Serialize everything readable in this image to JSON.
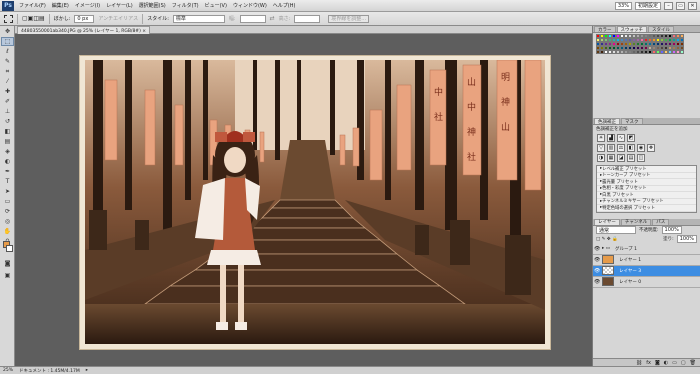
{
  "menubar": {
    "items": [
      "ファイル(F)",
      "編集(E)",
      "イメージ(I)",
      "レイヤー(L)",
      "選択範囲(S)",
      "フィルタ(T)",
      "ビュー(V)",
      "ウィンドウ(W)",
      "ヘルプ(H)"
    ],
    "zoom": "33%",
    "workspace": "初期設定"
  },
  "options": {
    "feather_label": "ぼかし:",
    "feather_value": "0 px",
    "antialias_label": "アンチエイリアス",
    "style_label": "スタイル:",
    "style_value": "標準",
    "width_label": "幅:",
    "height_label": "高さ:",
    "refine_label": "境界線を調整..."
  },
  "document": {
    "tab_label": "44803550001ab340.JPG @ 25% (レイヤー 1, RGB/8#) ×"
  },
  "statusbar": {
    "zoom": "25%",
    "doc_info": "ドキュメント : 1.45M/4.17M"
  },
  "panels": {
    "swatches_tabs": [
      "カラー",
      "スウォッチ",
      "スタイル"
    ],
    "swatch_colors": [
      "#ff0000",
      "#ffff00",
      "#00ff00",
      "#00ffff",
      "#0000ff",
      "#ff00ff",
      "#ffffff",
      "#ebebeb",
      "#d6d6d6",
      "#c2c2c2",
      "#adadad",
      "#999999",
      "#858585",
      "#707070",
      "#5c5c5c",
      "#474747",
      "#333333",
      "#1f1f1f",
      "#000000",
      "#f26d7d",
      "#f68e56",
      "#fbaf5c",
      "#fff467",
      "#acd372",
      "#7cc576",
      "#3bb878",
      "#1abbb4",
      "#00bff3",
      "#438cca",
      "#5574b9",
      "#605ca8",
      "#855fa8",
      "#a763a8",
      "#f06ea9",
      "#ed1c24",
      "#f26522",
      "#f7941d",
      "#fff200",
      "#8dc63f",
      "#39b54a",
      "#00a651",
      "#00a99d",
      "#00aeef",
      "#0072bc",
      "#0054a6",
      "#2e3192",
      "#662d91",
      "#92278f",
      "#ec008c",
      "#9e0b0f",
      "#a0410d",
      "#a36209",
      "#aba000",
      "#598527",
      "#1a7b30",
      "#007236",
      "#00746b",
      "#0076a3",
      "#004b80",
      "#003471",
      "#1b1464",
      "#440e62",
      "#630460",
      "#9e005d",
      "#790000",
      "#7b2e00",
      "#7d4900",
      "#827b00",
      "#406618",
      "#005e20",
      "#005826",
      "#005952",
      "#005b7f",
      "#003663",
      "#002157",
      "#0d004c",
      "#32004b",
      "#4b0049",
      "#7b0046",
      "#c7b299",
      "#998675",
      "#736357",
      "#534741",
      "#37302d",
      "#c69c6d",
      "#a67c52",
      "#8c6239",
      "#754c24",
      "#603913",
      "#42210b",
      "#ffffff",
      "#f2f2f2",
      "#e0e0e0",
      "#cccccc",
      "#b3b3b3",
      "#999999",
      "#808080",
      "#666666",
      "#4d4d4d",
      "#333333",
      "#1a1a1a",
      "#000000",
      "#ff6666",
      "#66ff66",
      "#6666ff",
      "#ffcc66",
      "#66ccff",
      "#cc66ff",
      "#ff99cc",
      "#99ffcc"
    ],
    "adjust_tabs": [
      "色調補正",
      "マスク"
    ],
    "adjust_title": "色調補正を追加",
    "presets": [
      "レベル補正 プリセット",
      "トーンカーブ プリセット",
      "露光量 プリセット",
      "色相・彩度 プリセット",
      "白黒 プリセット",
      "チャンネルミキサー プリセット",
      "特定色域の選択 プリセット"
    ],
    "layers_tabs": [
      "レイヤー",
      "チャンネル",
      "パス"
    ],
    "blend_mode": "通常",
    "opacity_label": "不透明度:",
    "opacity_value": "100%",
    "fill_label": "塗り:",
    "fill_value": "100%",
    "layers": [
      {
        "name": "グループ 1",
        "kind": "group",
        "selected": false
      },
      {
        "name": "レイヤー 1",
        "kind": "orange",
        "selected": false
      },
      {
        "name": "レイヤー 3",
        "kind": "transparent",
        "selected": true
      },
      {
        "name": "レイヤー 0",
        "kind": "photo",
        "selected": false
      }
    ]
  },
  "photo": {
    "banners": [
      "山",
      "中",
      "神",
      "社",
      "明",
      "神",
      "山",
      "中",
      "社"
    ],
    "accent": "#e9a37f",
    "sepia_dark": "#2b1a10",
    "sepia_light": "#d9b99c"
  }
}
